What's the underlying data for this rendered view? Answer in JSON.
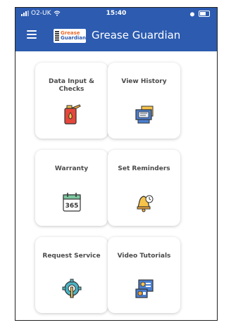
{
  "status": {
    "carrier": "O2-UK",
    "time": "15:40"
  },
  "header": {
    "logo_line1": "Grease",
    "logo_line2": "Guardian",
    "title": "Grease Guardian"
  },
  "cards": [
    {
      "label": "Data Input & Checks",
      "icon": "fuel-can-icon"
    },
    {
      "label": "View History",
      "icon": "history-folder-icon"
    },
    {
      "label": "Warranty",
      "icon": "calendar-365-icon"
    },
    {
      "label": "Set Reminders",
      "icon": "bell-clock-icon"
    },
    {
      "label": "Request Service",
      "icon": "gear-wrench-icon"
    },
    {
      "label": "Video Tutorials",
      "icon": "video-tutorial-icon"
    }
  ],
  "calendar_text": "365",
  "colors": {
    "primary": "#2c5bb0",
    "accent": "#e96b2d",
    "card_text": "#4a4a4a"
  }
}
